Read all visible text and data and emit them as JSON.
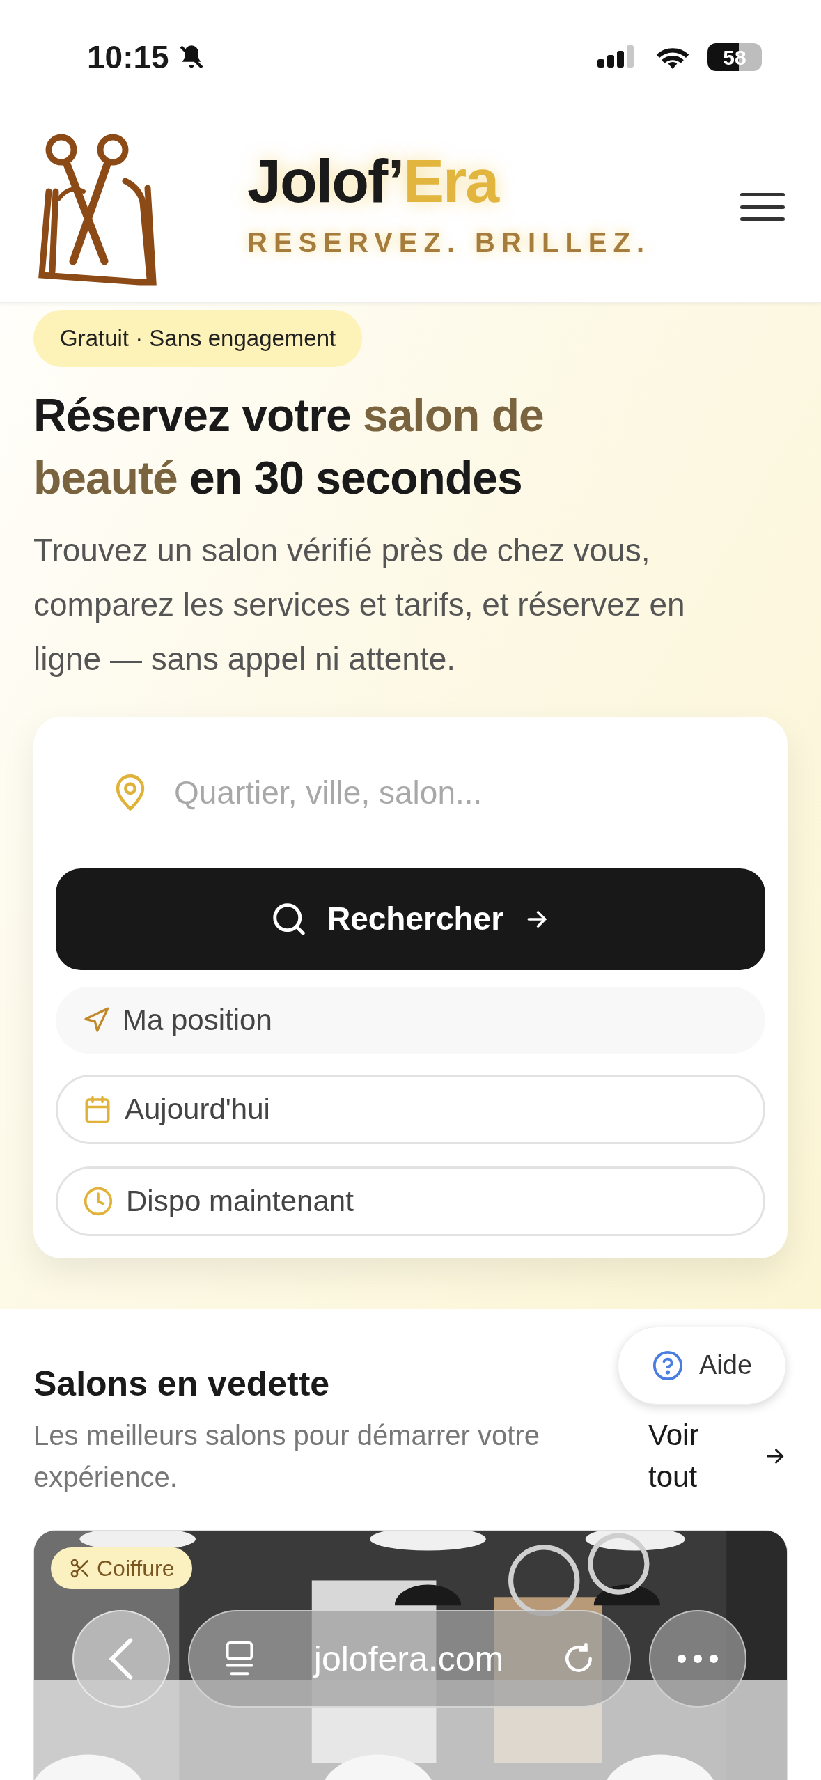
{
  "status_bar": {
    "time": "10:15",
    "battery": "58"
  },
  "header": {
    "brand_main": "Jolof’",
    "brand_accent": "Era",
    "tagline": "RESERVEZ. BRILLEZ."
  },
  "hero": {
    "badge": "Gratuit · Sans engagement",
    "heading": [
      {
        "text": "Réservez votre ",
        "accent": false
      },
      {
        "text": "salon de beauté",
        "accent": true
      },
      {
        "text": " en 30 secondes",
        "accent": false
      }
    ],
    "description": "Trouvez un salon vérifié près de chez vous, comparez les services et tarifs, et réservez en ligne — sans appel ni attente."
  },
  "search": {
    "placeholder": "Quartier, ville, salon...",
    "button": "Rechercher",
    "options": [
      {
        "kind": "location",
        "label": "Ma position"
      },
      {
        "kind": "date",
        "label": "Aujourd'hui"
      },
      {
        "kind": "time",
        "label": "Dispo maintenant"
      }
    ]
  },
  "help_button": "Aide",
  "featured": {
    "title": "Salons en vedette",
    "subtitle": "Les meilleurs salons pour démarrer votre expérience.",
    "see_all": "Voir tout",
    "salons": [
      {
        "kind": "picture",
        "category": "Coiffure"
      }
    ]
  },
  "browser_bar": {
    "url": "jolofera.com"
  }
}
